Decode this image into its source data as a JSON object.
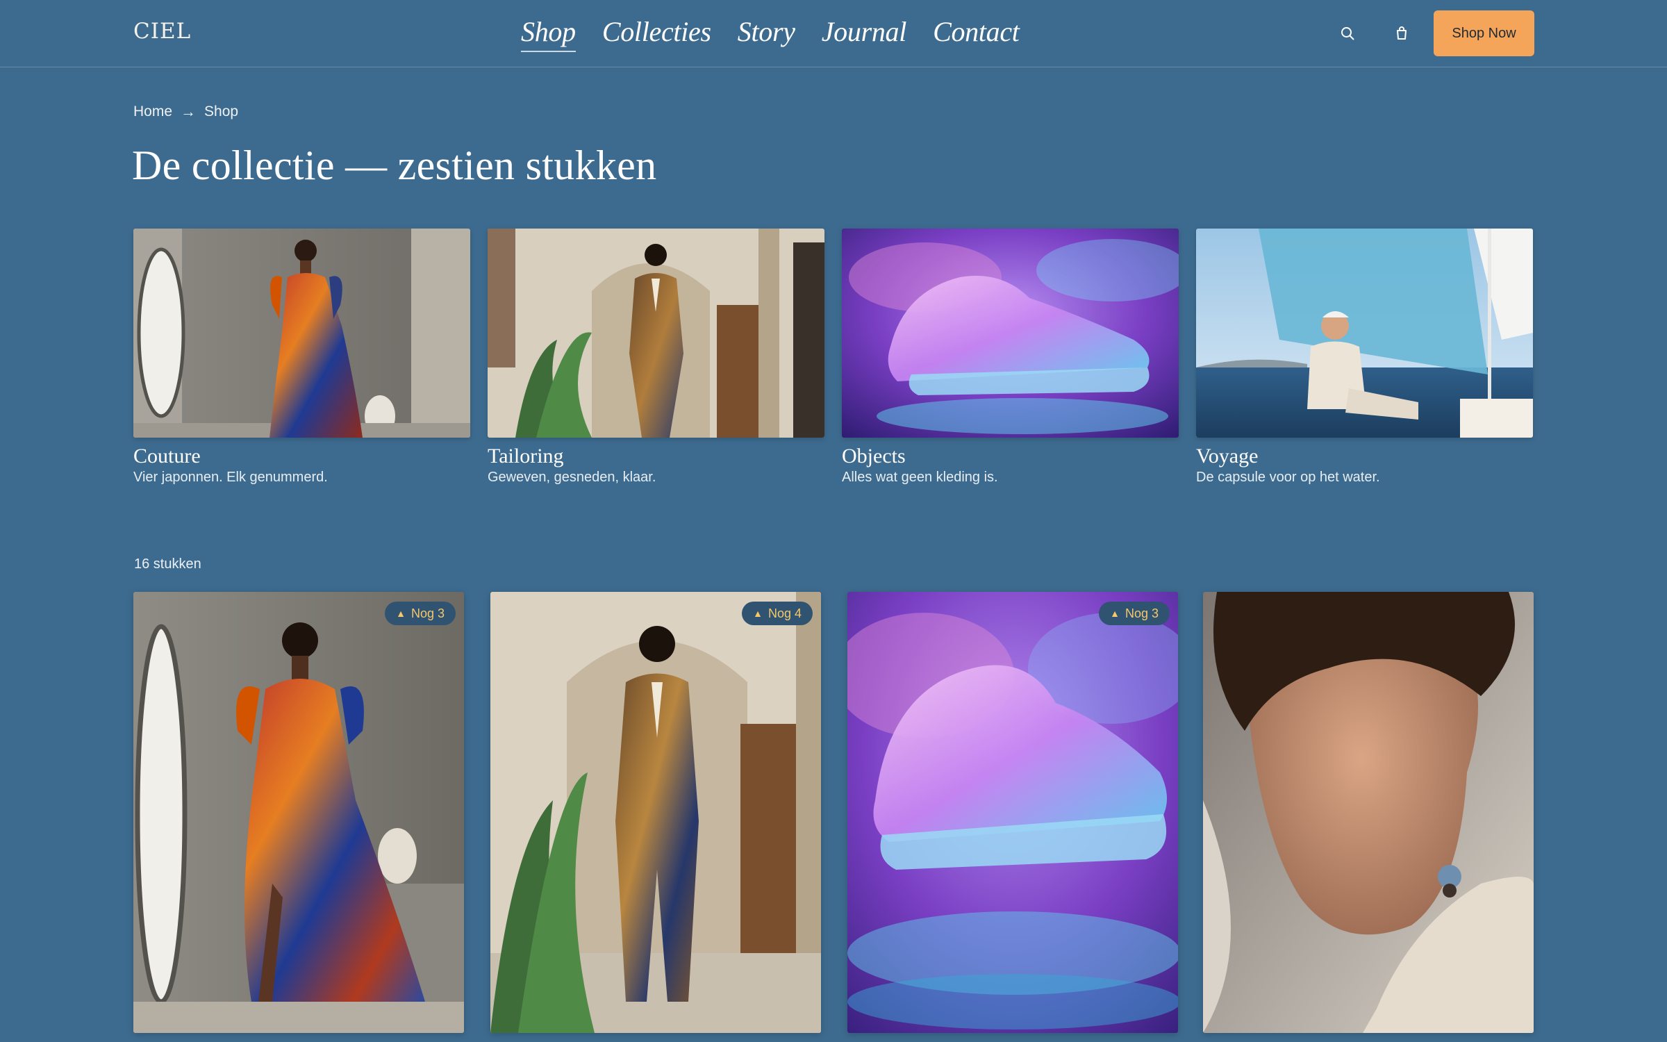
{
  "header": {
    "logo": "CIEL",
    "nav": [
      {
        "label": "Shop",
        "active": true
      },
      {
        "label": "Collecties",
        "active": false
      },
      {
        "label": "Story",
        "active": false
      },
      {
        "label": "Journal",
        "active": false
      },
      {
        "label": "Contact",
        "active": false
      }
    ],
    "icons": [
      "search-icon",
      "shopping-bag-icon"
    ],
    "cta_label": "Shop Now",
    "accent": "#f5a55a"
  },
  "breadcrumb": {
    "home": "Home",
    "separator": "→",
    "current": "Shop"
  },
  "page_title": "De collectie — zestien stukken",
  "categories": [
    {
      "name": "Couture",
      "desc": "Vier japonnen. Elk genummerd."
    },
    {
      "name": "Tailoring",
      "desc": "Geweven, gesneden, klaar."
    },
    {
      "name": "Objects",
      "desc": "Alles wat geen kleding is."
    },
    {
      "name": "Voyage",
      "desc": "De capsule voor op het water."
    }
  ],
  "product_count": "16 stukken",
  "products": [
    {
      "badge": "Nog 3"
    },
    {
      "badge": "Nog 4"
    },
    {
      "badge": "Nog 3"
    },
    {
      "badge": ""
    }
  ],
  "colors": {
    "background": "#3d6b8f",
    "badge_bg": "#2f5370",
    "badge_text": "#f6c86a"
  }
}
